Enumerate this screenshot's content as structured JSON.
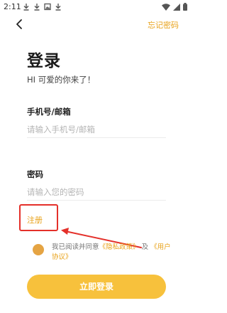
{
  "status_bar": {
    "time": "2:11",
    "left_icons": [
      "download-icon",
      "download-icon",
      "photo-icon",
      "download-icon"
    ],
    "right_icons": [
      "wifi-icon",
      "signal-icon",
      "battery-icon"
    ]
  },
  "header": {
    "back_icon": "chevron-left-icon",
    "forgot_password": "忘记密码"
  },
  "title": "登录",
  "subtitle": "HI 可爱的你来了！",
  "account": {
    "label": "手机号/邮箱",
    "placeholder": "请输入手机号/邮箱"
  },
  "password": {
    "label": "密码",
    "placeholder": "请输入您的密码"
  },
  "register": "注册",
  "agreement": {
    "prefix": "我已阅读并同意",
    "privacy": "《隐私政策》",
    "and": "及",
    "user": "《用户协议》"
  },
  "login_button": "立即登录",
  "colors": {
    "accent": "#e8a21a",
    "button": "#f7c13c",
    "annotation": "#e4302a"
  }
}
